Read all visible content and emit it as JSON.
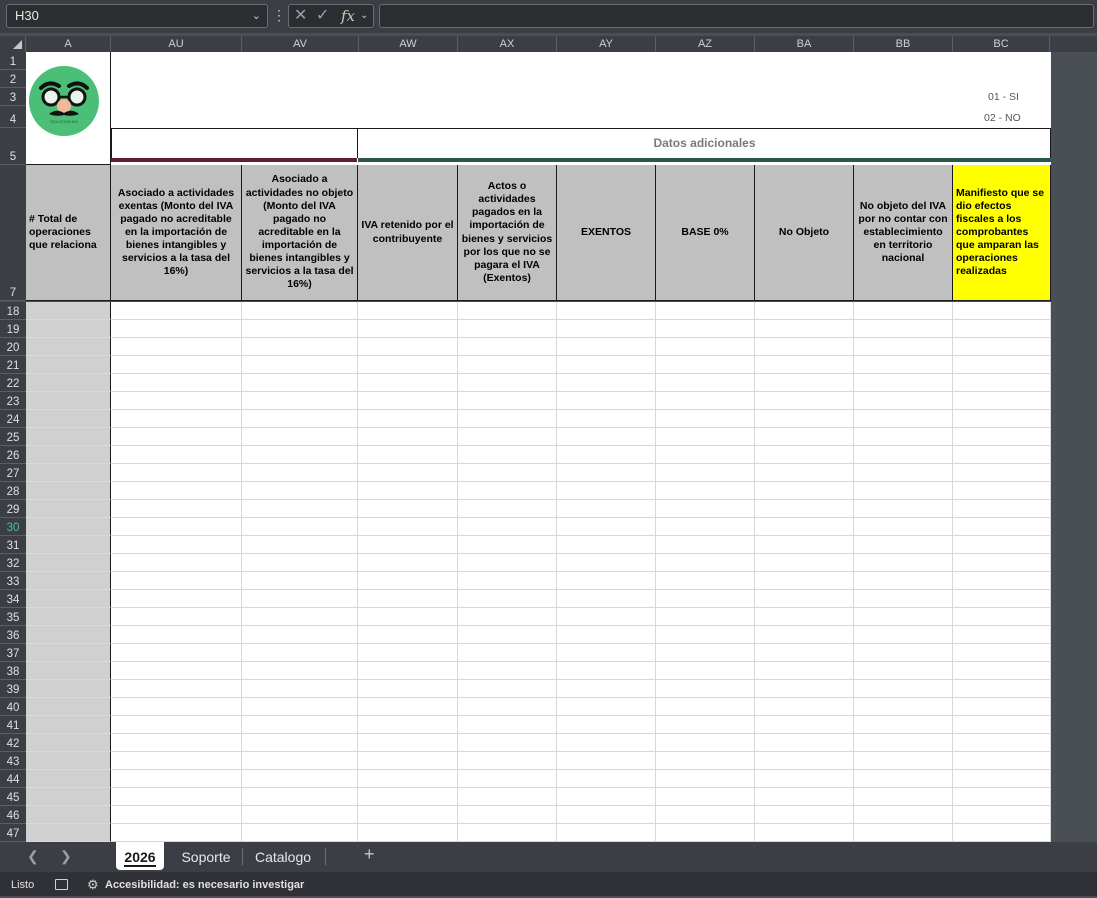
{
  "formula_bar": {
    "name_box": "H30",
    "formula": ""
  },
  "columns": [
    "A",
    "AU",
    "AV",
    "AW",
    "AX",
    "AY",
    "AZ",
    "BA",
    "BB",
    "BC"
  ],
  "rows": [
    "1",
    "2",
    "3",
    "4",
    "5",
    "7",
    "18",
    "19",
    "20",
    "21",
    "22",
    "23",
    "24",
    "25",
    "26",
    "27",
    "28",
    "29",
    "30",
    "31",
    "32",
    "33",
    "34",
    "35",
    "36",
    "37",
    "38",
    "39",
    "40",
    "41",
    "42",
    "43",
    "44",
    "45",
    "46",
    "47"
  ],
  "active_row": "30",
  "logo": {
    "text": "SOLUCION MX"
  },
  "legend": {
    "yes": "01 - SI",
    "no": "02 - NO"
  },
  "section_header": "Datos adicionales",
  "headers": {
    "a": "# Total de operaciones que relaciona",
    "au": "Asociado a actividades exentas (Monto del IVA pagado no acreditable en la importación de bienes intangibles y servicios a la tasa del 16%)",
    "av": "Asociado a actividades no objeto (Monto del IVA pagado no acreditable en la importación de bienes intangibles y servicios a la tasa del 16%)",
    "aw": "IVA retenido por el contribuyente",
    "ax": "Actos o actividades pagados en la importación de bienes y servicios por los que no se pagara el IVA (Exentos)",
    "ay": "EXENTOS",
    "az": "BASE 0%",
    "ba": "No Objeto",
    "bb": "No objeto del IVA por  no contar con establecimiento en territorio nacional",
    "bc": "Manifiesto que se dio efectos fiscales a los comprobantes que amparan las operaciones realizadas"
  },
  "colors": {
    "logo_green": "#4bbf78",
    "maroon_bar": "#5e1f2d",
    "green_bar": "#27584a",
    "header_gray": "#c0c0c0",
    "highlight_yellow": "#ffff00"
  },
  "tabs": [
    "2026",
    "Soporte",
    "Catalogo"
  ],
  "active_tab": "2026",
  "status": {
    "ready": "Listo",
    "accessibility": "Accesibilidad: es necesario investigar"
  }
}
